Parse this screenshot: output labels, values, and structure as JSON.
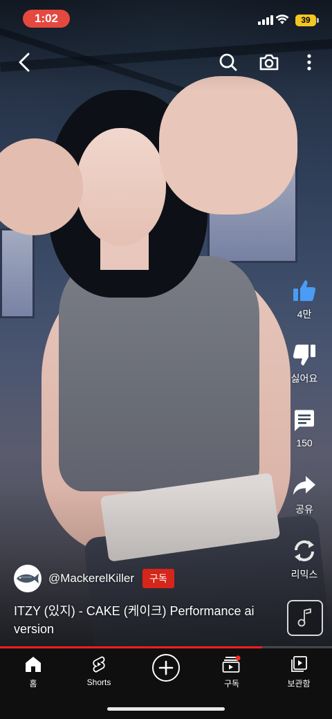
{
  "status_bar": {
    "time": "1:02",
    "battery": "39"
  },
  "actions": {
    "like_count": "4만",
    "dislike_label": "싫어요",
    "comment_count": "150",
    "share_label": "공유",
    "remix_label": "리믹스"
  },
  "video": {
    "channel_handle": "@MackerelKiller",
    "subscribe_label": "구독",
    "title": "ITZY (있지) - CAKE (케이크) Performance ai version",
    "progress": 0.79
  },
  "nav": {
    "items": [
      {
        "label": "홈"
      },
      {
        "label": "Shorts"
      },
      {
        "label": ""
      },
      {
        "label": "구독"
      },
      {
        "label": "보관함"
      }
    ]
  },
  "colors": {
    "accent": "#ff1e1e",
    "subscribe": "#d6251a",
    "time_pill": "#e5483f",
    "battery": "#f3c623",
    "like_blue": "#4a9cf5"
  }
}
